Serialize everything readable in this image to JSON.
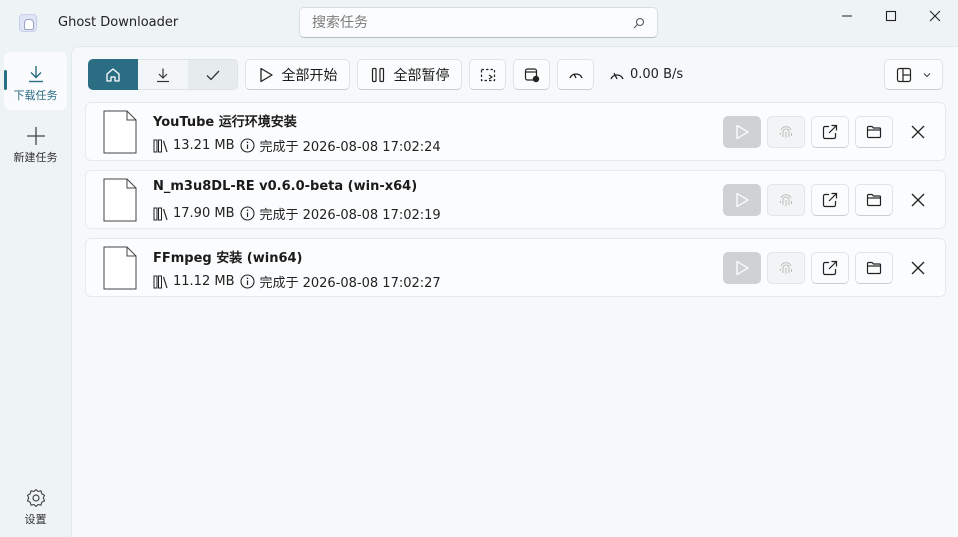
{
  "app": {
    "title": "Ghost Downloader"
  },
  "search": {
    "placeholder": "搜索任务",
    "value": ""
  },
  "window_controls": {
    "minimize_icon": "minimize-icon",
    "maximize_icon": "maximize-icon",
    "close_icon": "close-icon"
  },
  "sidebar": {
    "items": [
      {
        "label": "下载任务",
        "icon": "download-icon",
        "active": true
      },
      {
        "label": "新建任务",
        "icon": "plus-icon",
        "active": false
      }
    ],
    "settings": {
      "label": "设置",
      "icon": "gear-icon"
    }
  },
  "toolbar": {
    "start_all_label": "全部开始",
    "pause_all_label": "全部暂停",
    "speed": "0.00 B/s",
    "accent": "#2b6d82"
  },
  "tasks": [
    {
      "name": "YouTube 运行环境安装",
      "size": "13.21 MB",
      "status": "完成于 2026-08-08 17:02:24"
    },
    {
      "name": "N_m3u8DL-RE v0.6.0-beta (win-x64)",
      "size": "17.90 MB",
      "status": "完成于 2026-08-08 17:02:19"
    },
    {
      "name": "FFmpeg 安装 (win64)",
      "size": "11.12 MB",
      "status": "完成于 2026-08-08 17:02:27"
    }
  ]
}
